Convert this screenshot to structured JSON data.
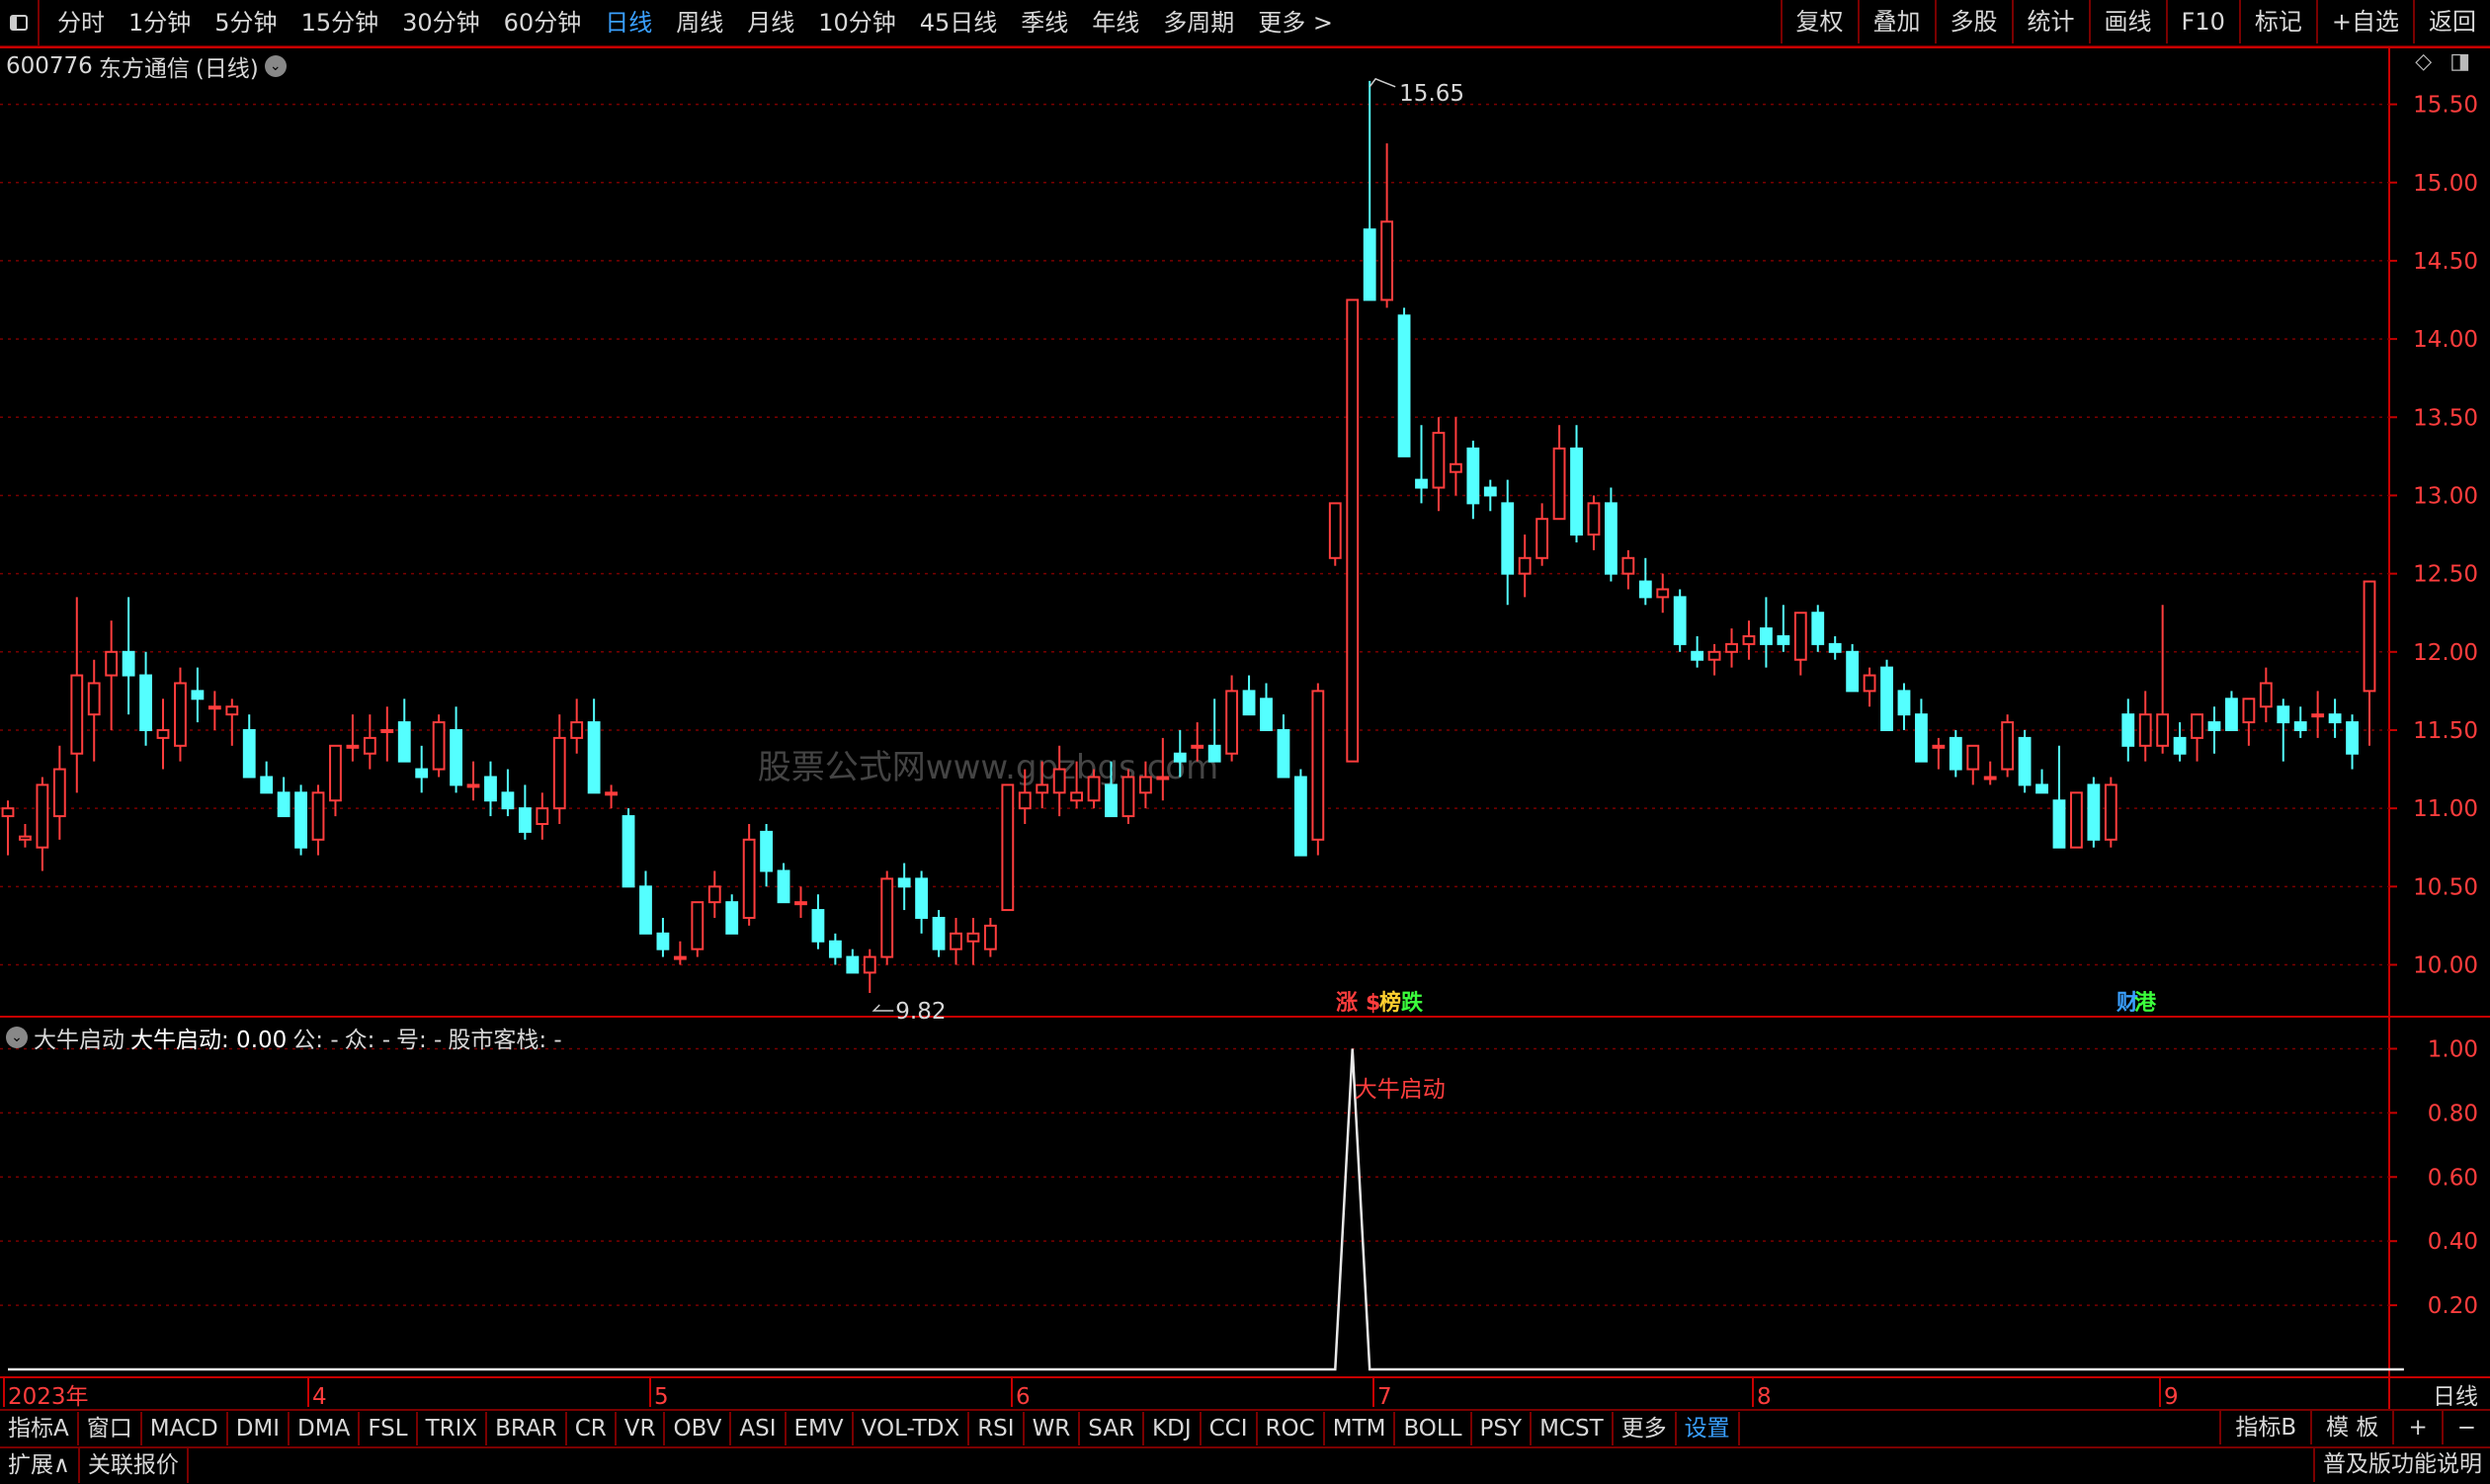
{
  "toolbar": {
    "periods": [
      "分时",
      "1分钟",
      "5分钟",
      "15分钟",
      "30分钟",
      "60分钟",
      "日线",
      "周线",
      "月线",
      "10分钟",
      "45日线",
      "季线",
      "年线",
      "多周期",
      "更多 >"
    ],
    "active_period": "日线",
    "right_buttons": [
      "复权",
      "叠加",
      "多股",
      "统计",
      "画线",
      "F10",
      "标记",
      "+自选",
      "返回"
    ]
  },
  "stock": {
    "code": "600776",
    "name": "东方通信",
    "period": "(日线)"
  },
  "watermark": "股票公式网www.gpzbgs.com",
  "indicator": {
    "name": "大牛启动",
    "line": "大牛启动: 0.00",
    "gong": "公: -",
    "zhong": "众: -",
    "hao": "号: -",
    "gushi": "股市客栈: -"
  },
  "colors": {
    "up": "#ff3d3d",
    "down": "#54ffff",
    "axis": "#c80000",
    "grid": "#7a0000",
    "active": "#3aa0ff"
  },
  "chart_data": [
    {
      "type": "candlestick",
      "ylim": [
        9.7,
        15.75
      ],
      "yticks": [
        "15.50",
        "15.00",
        "14.50",
        "14.00",
        "13.50",
        "13.00",
        "12.50",
        "12.00",
        "11.50",
        "11.00",
        "10.50",
        "10.00"
      ],
      "xlabels": [
        "2023年",
        "4",
        "5",
        "6",
        "7",
        "8",
        "9"
      ],
      "high_label": "15.65",
      "low_label": "9.82",
      "event_labels": [
        {
          "text": "涨",
          "color": "#ff3d3d"
        },
        {
          "text": "$",
          "color": "#ff3d3d"
        },
        {
          "text": "榜",
          "color": "#ffd030"
        },
        {
          "text": "跌",
          "color": "#3cff3c"
        },
        {
          "text": "财",
          "color": "#3aa0ff"
        },
        {
          "text": "港",
          "color": "#3cff3c"
        }
      ],
      "ohlc": [
        [
          10.95,
          11.05,
          10.7,
          11.0
        ],
        [
          10.8,
          10.9,
          10.75,
          10.82
        ],
        [
          10.75,
          11.2,
          10.6,
          11.15
        ],
        [
          10.95,
          11.4,
          10.8,
          11.25
        ],
        [
          11.35,
          12.35,
          11.1,
          11.85
        ],
        [
          11.6,
          11.95,
          11.3,
          11.8
        ],
        [
          11.85,
          12.2,
          11.5,
          12.0
        ],
        [
          12.0,
          12.35,
          11.6,
          11.85
        ],
        [
          11.85,
          12.0,
          11.4,
          11.5
        ],
        [
          11.45,
          11.7,
          11.25,
          11.5
        ],
        [
          11.4,
          11.9,
          11.3,
          11.8
        ],
        [
          11.75,
          11.9,
          11.55,
          11.7
        ],
        [
          11.65,
          11.75,
          11.5,
          11.65
        ],
        [
          11.6,
          11.7,
          11.4,
          11.65
        ],
        [
          11.5,
          11.6,
          11.25,
          11.2
        ],
        [
          11.2,
          11.3,
          11.1,
          11.1
        ],
        [
          11.1,
          11.2,
          10.95,
          10.95
        ],
        [
          11.1,
          11.15,
          10.7,
          10.75
        ],
        [
          10.8,
          11.15,
          10.7,
          11.1
        ],
        [
          11.05,
          11.4,
          10.95,
          11.4
        ],
        [
          11.4,
          11.6,
          11.3,
          11.4
        ],
        [
          11.35,
          11.6,
          11.25,
          11.45
        ],
        [
          11.5,
          11.65,
          11.3,
          11.5
        ],
        [
          11.55,
          11.7,
          11.3,
          11.3
        ],
        [
          11.25,
          11.4,
          11.1,
          11.2
        ],
        [
          11.25,
          11.6,
          11.2,
          11.55
        ],
        [
          11.5,
          11.65,
          11.1,
          11.15
        ],
        [
          11.15,
          11.3,
          11.05,
          11.15
        ],
        [
          11.2,
          11.3,
          10.95,
          11.05
        ],
        [
          11.1,
          11.25,
          10.95,
          11.0
        ],
        [
          11.0,
          11.15,
          10.8,
          10.85
        ],
        [
          10.9,
          11.1,
          10.8,
          11.0
        ],
        [
          11.0,
          11.6,
          10.9,
          11.45
        ],
        [
          11.45,
          11.7,
          11.35,
          11.55
        ],
        [
          11.55,
          11.7,
          11.15,
          11.1
        ],
        [
          11.1,
          11.15,
          11.0,
          11.1
        ],
        [
          10.95,
          11.0,
          10.5,
          10.5
        ],
        [
          10.5,
          10.6,
          10.25,
          10.2
        ],
        [
          10.2,
          10.3,
          10.05,
          10.1
        ],
        [
          10.05,
          10.15,
          10.0,
          10.05
        ],
        [
          10.1,
          10.4,
          10.05,
          10.4
        ],
        [
          10.4,
          10.6,
          10.3,
          10.5
        ],
        [
          10.4,
          10.45,
          10.2,
          10.2
        ],
        [
          10.3,
          10.9,
          10.25,
          10.8
        ],
        [
          10.85,
          10.9,
          10.5,
          10.6
        ],
        [
          10.6,
          10.65,
          10.4,
          10.4
        ],
        [
          10.4,
          10.5,
          10.3,
          10.4
        ],
        [
          10.35,
          10.45,
          10.1,
          10.15
        ],
        [
          10.15,
          10.2,
          10.0,
          10.05
        ],
        [
          10.05,
          10.1,
          9.95,
          9.95
        ],
        [
          9.95,
          10.1,
          9.82,
          10.05
        ],
        [
          10.05,
          10.6,
          10.0,
          10.55
        ],
        [
          10.55,
          10.65,
          10.35,
          10.5
        ],
        [
          10.55,
          10.6,
          10.2,
          10.3
        ],
        [
          10.3,
          10.35,
          10.05,
          10.1
        ],
        [
          10.1,
          10.3,
          10.0,
          10.2
        ],
        [
          10.15,
          10.3,
          10.0,
          10.2
        ],
        [
          10.1,
          10.3,
          10.05,
          10.25
        ],
        [
          10.35,
          11.15,
          10.35,
          11.15
        ],
        [
          11.0,
          11.25,
          10.9,
          11.1
        ],
        [
          11.1,
          11.3,
          11.0,
          11.15
        ],
        [
          11.1,
          11.4,
          10.95,
          11.25
        ],
        [
          11.05,
          11.3,
          11.0,
          11.1
        ],
        [
          11.05,
          11.25,
          11.0,
          11.2
        ],
        [
          11.15,
          11.3,
          10.95,
          10.95
        ],
        [
          10.95,
          11.25,
          10.9,
          11.2
        ],
        [
          11.1,
          11.3,
          11.0,
          11.2
        ],
        [
          11.2,
          11.45,
          11.05,
          11.2
        ],
        [
          11.35,
          11.5,
          11.2,
          11.3
        ],
        [
          11.4,
          11.55,
          11.3,
          11.4
        ],
        [
          11.4,
          11.7,
          11.3,
          11.3
        ],
        [
          11.35,
          11.85,
          11.3,
          11.75
        ],
        [
          11.75,
          11.85,
          11.6,
          11.6
        ],
        [
          11.7,
          11.8,
          11.5,
          11.5
        ],
        [
          11.5,
          11.6,
          11.2,
          11.2
        ],
        [
          11.2,
          11.25,
          10.75,
          10.7
        ],
        [
          10.8,
          11.8,
          10.7,
          11.75
        ],
        [
          12.6,
          12.95,
          12.55,
          12.95
        ],
        [
          11.3,
          14.25,
          12.3,
          14.25
        ],
        [
          14.7,
          15.65,
          14.25,
          14.25
        ],
        [
          14.25,
          15.25,
          14.2,
          14.75
        ],
        [
          14.15,
          14.2,
          13.25,
          13.25
        ],
        [
          13.1,
          13.45,
          12.95,
          13.05
        ],
        [
          13.05,
          13.5,
          12.9,
          13.4
        ],
        [
          13.15,
          13.5,
          13.0,
          13.2
        ],
        [
          13.3,
          13.35,
          12.85,
          12.95
        ],
        [
          13.05,
          13.1,
          12.9,
          13.0
        ],
        [
          12.95,
          13.1,
          12.3,
          12.5
        ],
        [
          12.5,
          12.75,
          12.35,
          12.6
        ],
        [
          12.6,
          12.95,
          12.55,
          12.85
        ],
        [
          12.85,
          13.45,
          12.85,
          13.3
        ],
        [
          13.3,
          13.45,
          12.7,
          12.75
        ],
        [
          12.75,
          13.0,
          12.65,
          12.95
        ],
        [
          12.95,
          13.05,
          12.45,
          12.5
        ],
        [
          12.5,
          12.65,
          12.4,
          12.6
        ],
        [
          12.45,
          12.6,
          12.3,
          12.35
        ],
        [
          12.35,
          12.5,
          12.25,
          12.4
        ],
        [
          12.35,
          12.4,
          12.0,
          12.05
        ],
        [
          12.0,
          12.1,
          11.9,
          11.95
        ],
        [
          11.95,
          12.05,
          11.85,
          12.0
        ],
        [
          12.0,
          12.15,
          11.9,
          12.05
        ],
        [
          12.05,
          12.2,
          11.95,
          12.1
        ],
        [
          12.15,
          12.35,
          11.9,
          12.05
        ],
        [
          12.1,
          12.3,
          12.0,
          12.05
        ],
        [
          11.95,
          12.2,
          11.85,
          12.25
        ],
        [
          12.25,
          12.3,
          12.0,
          12.05
        ],
        [
          12.05,
          12.1,
          11.95,
          12.0
        ],
        [
          12.0,
          12.05,
          11.75,
          11.75
        ],
        [
          11.75,
          11.9,
          11.65,
          11.85
        ],
        [
          11.9,
          11.95,
          11.5,
          11.5
        ],
        [
          11.75,
          11.8,
          11.5,
          11.6
        ],
        [
          11.6,
          11.7,
          11.3,
          11.3
        ],
        [
          11.4,
          11.45,
          11.25,
          11.4
        ],
        [
          11.45,
          11.5,
          11.2,
          11.25
        ],
        [
          11.25,
          11.4,
          11.15,
          11.4
        ],
        [
          11.2,
          11.3,
          11.15,
          11.2
        ],
        [
          11.25,
          11.6,
          11.2,
          11.55
        ],
        [
          11.45,
          11.5,
          11.1,
          11.15
        ],
        [
          11.15,
          11.25,
          11.1,
          11.1
        ],
        [
          11.05,
          11.4,
          10.85,
          10.75
        ],
        [
          10.75,
          10.85,
          10.9,
          11.1
        ],
        [
          11.15,
          11.2,
          10.75,
          10.8
        ],
        [
          10.8,
          11.2,
          10.75,
          11.15
        ],
        [
          11.6,
          11.7,
          11.3,
          11.4
        ],
        [
          11.4,
          11.75,
          11.3,
          11.6
        ],
        [
          11.4,
          12.3,
          11.35,
          11.6
        ],
        [
          11.45,
          11.55,
          11.3,
          11.35
        ],
        [
          11.45,
          11.6,
          11.3,
          11.6
        ],
        [
          11.55,
          11.65,
          11.35,
          11.5
        ],
        [
          11.7,
          11.75,
          11.5,
          11.5
        ],
        [
          11.55,
          11.7,
          11.4,
          11.7
        ],
        [
          11.65,
          11.9,
          11.55,
          11.8
        ],
        [
          11.65,
          11.7,
          11.3,
          11.55
        ],
        [
          11.55,
          11.65,
          11.45,
          11.5
        ],
        [
          11.6,
          11.75,
          11.45,
          11.6
        ],
        [
          11.6,
          11.7,
          11.45,
          11.55
        ],
        [
          11.55,
          11.6,
          11.25,
          11.35
        ],
        [
          11.75,
          12.45,
          11.4,
          12.45
        ]
      ]
    },
    {
      "type": "line",
      "name": "大牛启动",
      "ylim": [
        0,
        1.1
      ],
      "yticks": [
        "1.00",
        "0.80",
        "0.60",
        "0.40",
        "0.20"
      ],
      "peak_label": "大牛启动",
      "signal_index": 78,
      "count": 140
    }
  ],
  "bottom": {
    "tabs": [
      "指标A",
      "窗口",
      "MACD",
      "DMI",
      "DMA",
      "FSL",
      "TRIX",
      "BRAR",
      "CR",
      "VR",
      "OBV",
      "ASI",
      "EMV",
      "VOL-TDX",
      "RSI",
      "WR",
      "SAR",
      "KDJ",
      "CCI",
      "ROC",
      "MTM",
      "BOLL",
      "PSY",
      "MCST",
      "更多",
      "设置"
    ],
    "right_tabs": [
      "指标B",
      "模 板",
      "+",
      "−"
    ],
    "period_label": "日线"
  },
  "status": {
    "expand": "扩展∧",
    "related": "关联报价",
    "right": "普及版功能说明"
  }
}
